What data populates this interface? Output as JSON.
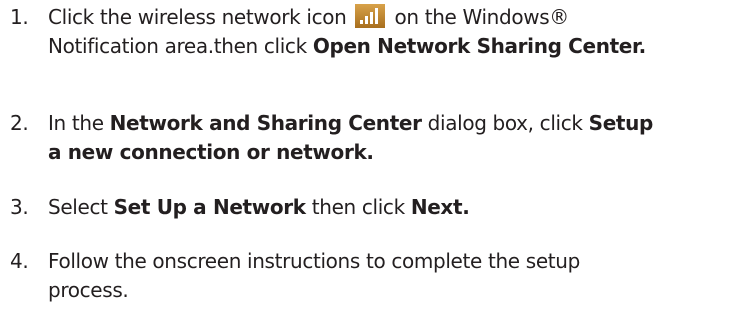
{
  "steps": [
    {
      "number": "1.",
      "line1_pre": "Click the wireless network icon",
      "line1_post": "on the Windows®",
      "line2_pre": "Notification area.then click",
      "line2_bold": "Open Network Sharing Center."
    },
    {
      "number": "2.",
      "line1_pre": "In the",
      "line1_bold": "Network and Sharing Center",
      "line1_mid": "dialog box, click",
      "line1_bold2": "Setup",
      "line2_bold": "a new connection or network."
    },
    {
      "number": "3.",
      "pre": "Select",
      "bold": "Set Up a Network",
      "mid": "then click",
      "bold2": "Next."
    },
    {
      "number": "4.",
      "line1": "Follow the onscreen instructions to complete the setup",
      "line2": "process."
    }
  ],
  "icons": {
    "wireless_icon": "wireless-signal-icon",
    "icon_bg": "#c58a2c",
    "icon_bar": "#ffffff"
  }
}
